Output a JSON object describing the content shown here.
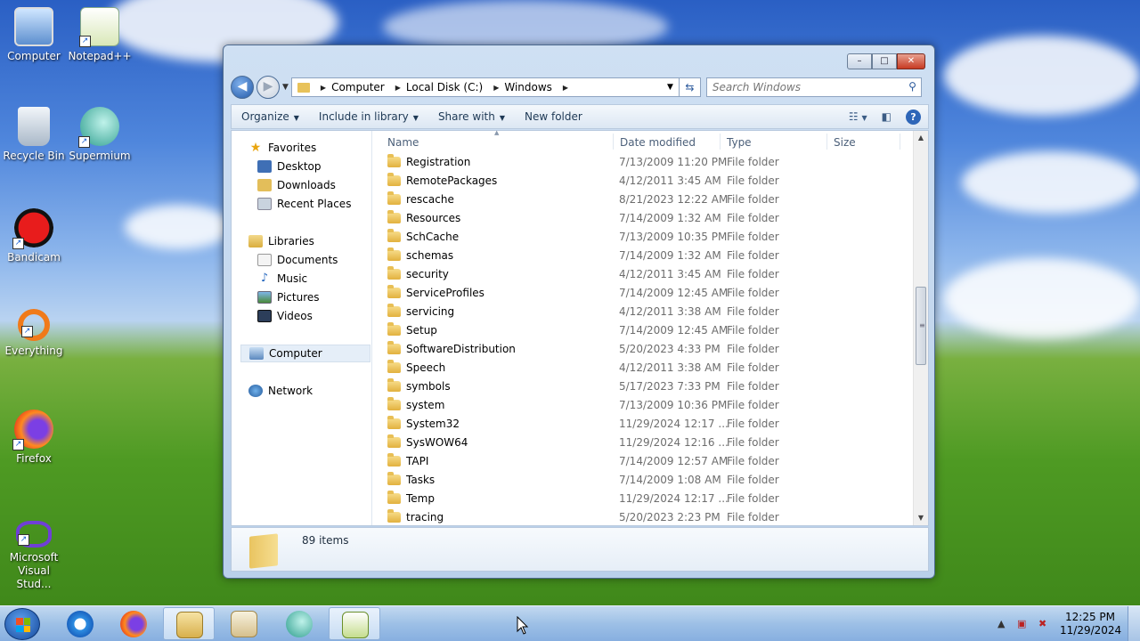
{
  "desktop": {
    "icons": [
      {
        "label": "Computer",
        "icon": "computer-icon"
      },
      {
        "label": "Notepad++",
        "icon": "notepadpp-icon"
      },
      {
        "label": "Recycle Bin",
        "icon": "recycle-bin-icon"
      },
      {
        "label": "Supermium",
        "icon": "supermium-icon"
      },
      {
        "label": "Bandicam",
        "icon": "bandicam-icon"
      },
      {
        "label": "Everything",
        "icon": "everything-icon"
      },
      {
        "label": "Firefox",
        "icon": "firefox-icon"
      },
      {
        "label": "Microsoft Visual Stud...",
        "icon": "visual-studio-icon"
      }
    ]
  },
  "window": {
    "controls": {
      "minimize": "–",
      "maximize": "□",
      "close": "✕"
    },
    "breadcrumb": [
      "Computer",
      "Local Disk (C:)",
      "Windows"
    ],
    "search": {
      "placeholder": "Search Windows"
    },
    "toolbar": {
      "organize": "Organize",
      "include_in_library": "Include in library",
      "share_with": "Share with",
      "new_folder": "New folder"
    },
    "nav_pane": {
      "favorites": "Favorites",
      "desktop": "Desktop",
      "downloads": "Downloads",
      "recent_places": "Recent Places",
      "libraries": "Libraries",
      "documents": "Documents",
      "music": "Music",
      "pictures": "Pictures",
      "videos": "Videos",
      "computer": "Computer",
      "network": "Network"
    },
    "columns": {
      "name": "Name",
      "date_modified": "Date modified",
      "type": "Type",
      "size": "Size"
    },
    "files": [
      {
        "name": "Registration",
        "date": "7/13/2009 11:20 PM",
        "type": "File folder"
      },
      {
        "name": "RemotePackages",
        "date": "4/12/2011 3:45 AM",
        "type": "File folder"
      },
      {
        "name": "rescache",
        "date": "8/21/2023 12:22 AM",
        "type": "File folder"
      },
      {
        "name": "Resources",
        "date": "7/14/2009 1:32 AM",
        "type": "File folder"
      },
      {
        "name": "SchCache",
        "date": "7/13/2009 10:35 PM",
        "type": "File folder"
      },
      {
        "name": "schemas",
        "date": "7/14/2009 1:32 AM",
        "type": "File folder"
      },
      {
        "name": "security",
        "date": "4/12/2011 3:45 AM",
        "type": "File folder"
      },
      {
        "name": "ServiceProfiles",
        "date": "7/14/2009 12:45 AM",
        "type": "File folder"
      },
      {
        "name": "servicing",
        "date": "4/12/2011 3:38 AM",
        "type": "File folder"
      },
      {
        "name": "Setup",
        "date": "7/14/2009 12:45 AM",
        "type": "File folder"
      },
      {
        "name": "SoftwareDistribution",
        "date": "5/20/2023 4:33 PM",
        "type": "File folder"
      },
      {
        "name": "Speech",
        "date": "4/12/2011 3:38 AM",
        "type": "File folder"
      },
      {
        "name": "symbols",
        "date": "5/17/2023 7:33 PM",
        "type": "File folder"
      },
      {
        "name": "system",
        "date": "7/13/2009 10:36 PM",
        "type": "File folder"
      },
      {
        "name": "System32",
        "date": "11/29/2024 12:17 ...",
        "type": "File folder"
      },
      {
        "name": "SysWOW64",
        "date": "11/29/2024 12:16 ...",
        "type": "File folder"
      },
      {
        "name": "TAPI",
        "date": "7/14/2009 12:57 AM",
        "type": "File folder"
      },
      {
        "name": "Tasks",
        "date": "7/14/2009 1:08 AM",
        "type": "File folder"
      },
      {
        "name": "Temp",
        "date": "11/29/2024 12:17 ...",
        "type": "File folder"
      },
      {
        "name": "tracing",
        "date": "5/20/2023 2:23 PM",
        "type": "File folder"
      }
    ],
    "details": {
      "item_count": "89 items"
    }
  },
  "taskbar": {
    "apps": [
      "internet-explorer-icon",
      "firefox-icon",
      "windows-explorer-icon",
      "media-player-icon",
      "supermium-icon",
      "notepadpp-icon"
    ],
    "clock": {
      "time": "12:25 PM",
      "date": "11/29/2024"
    }
  }
}
